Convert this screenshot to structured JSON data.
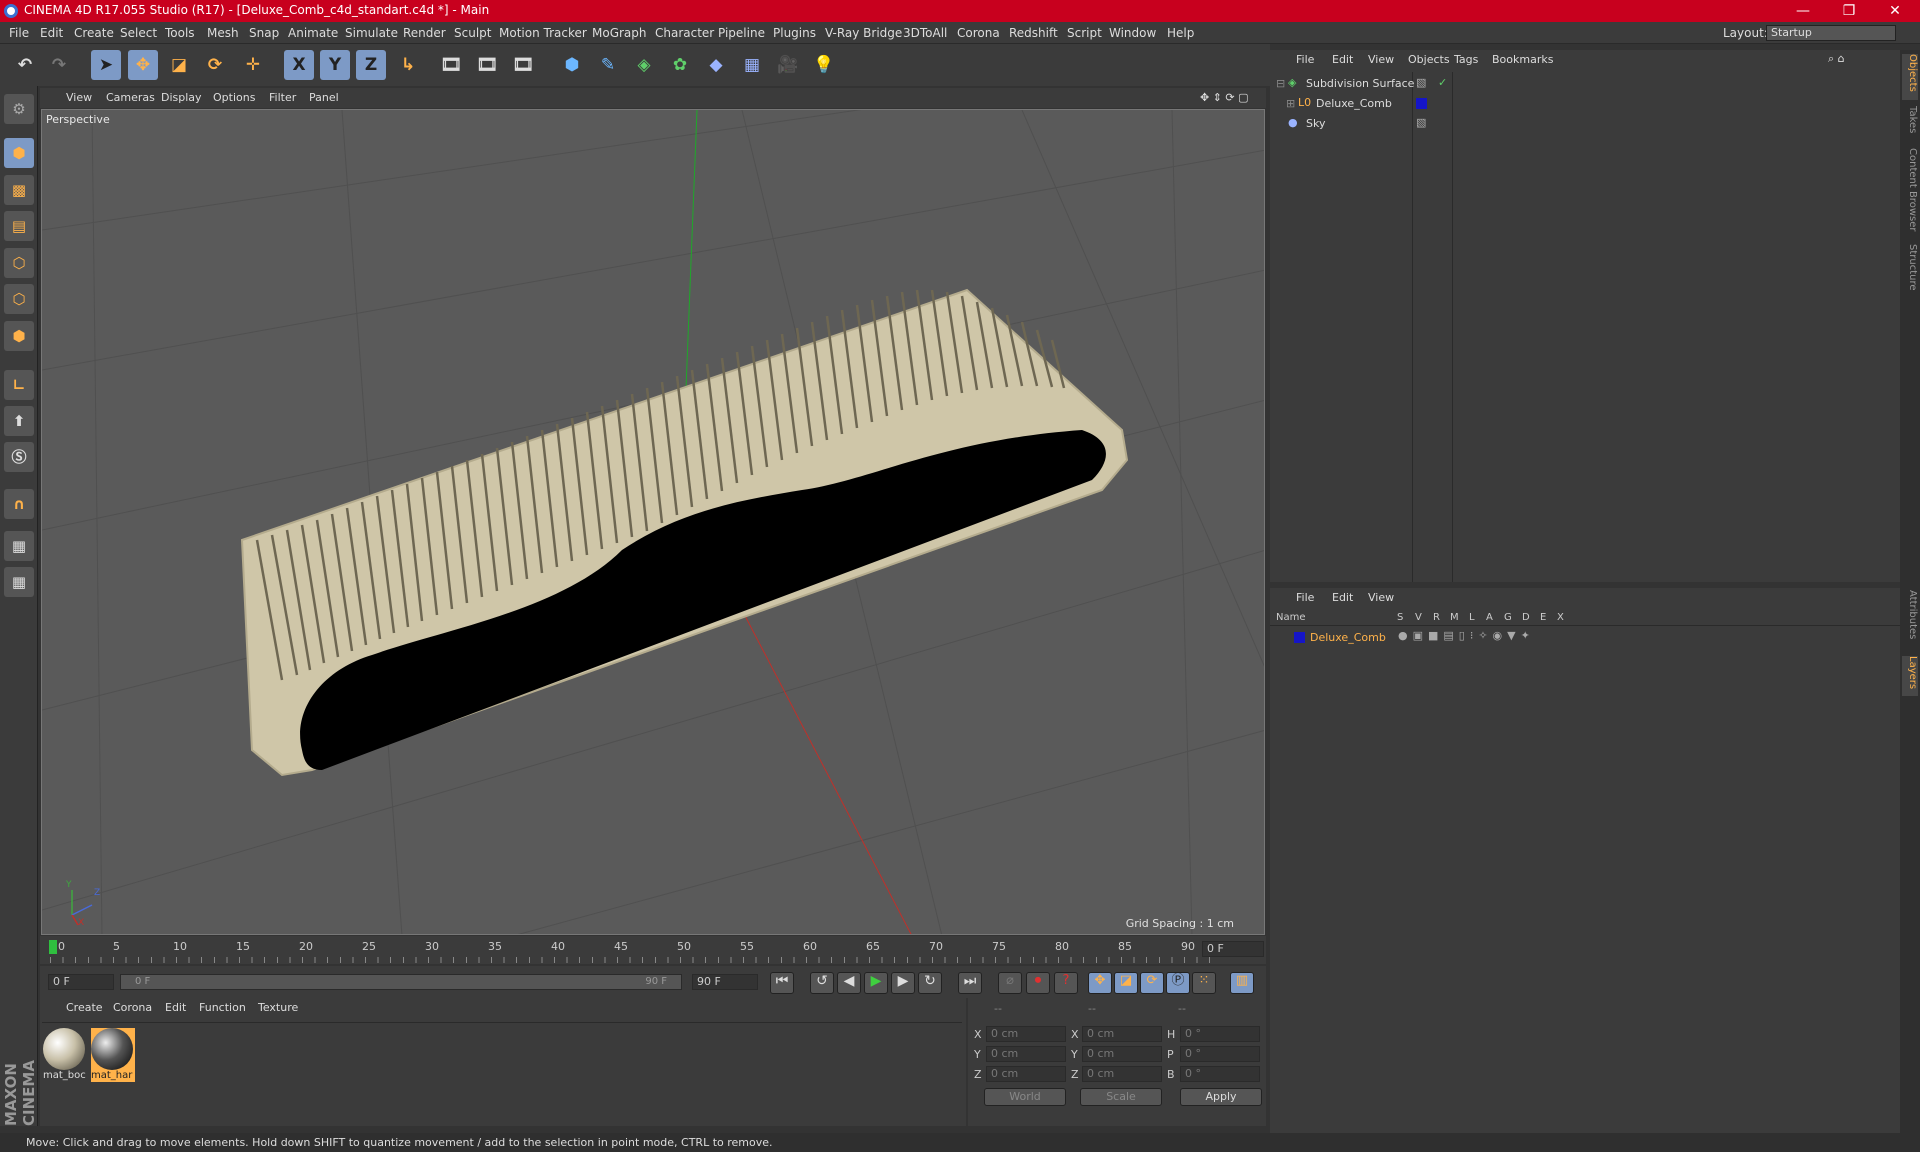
{
  "window": {
    "title": "CINEMA 4D R17.055 Studio (R17) - [Deluxe_Comb_c4d_standart.c4d *] - Main",
    "controls": [
      "—",
      "❐",
      "✕"
    ]
  },
  "menubar": {
    "items": [
      "File",
      "Edit",
      "Create",
      "Select",
      "Tools",
      "Mesh",
      "Snap",
      "Animate",
      "Simulate",
      "Render",
      "Sculpt",
      "Motion Tracker",
      "MoGraph",
      "Character",
      "Pipeline",
      "Plugins",
      "V-Ray Bridge",
      "3DToAll",
      "Corona",
      "Redshift",
      "Script",
      "Window",
      "Help"
    ],
    "layout_label": "Layout:",
    "layout_value": "Startup"
  },
  "toolbar": {
    "axis_x": "X",
    "axis_y": "Y",
    "axis_z": "Z"
  },
  "viewport": {
    "menu": [
      "View",
      "Cameras",
      "Display",
      "Options",
      "Filter",
      "Panel"
    ],
    "camera_label": "Perspective",
    "grid_spacing": "Grid Spacing : 1 cm",
    "axis_labels": {
      "x": "X",
      "y": "Y",
      "z": "Z"
    }
  },
  "timeline": {
    "ticks": [
      "0",
      "5",
      "10",
      "15",
      "20",
      "25",
      "30",
      "35",
      "40",
      "45",
      "50",
      "55",
      "60",
      "65",
      "70",
      "75",
      "80",
      "85",
      "90"
    ],
    "current_frame_field": "0 F",
    "start_field": "0 F",
    "range_start": "0 F",
    "range_end": "90 F",
    "end_field": "90 F"
  },
  "materials": {
    "menu": [
      "Create",
      "Corona",
      "Edit",
      "Function",
      "Texture"
    ],
    "items": [
      {
        "name": "mat_boc",
        "selected": false
      },
      {
        "name": "mat_har",
        "selected": true
      }
    ]
  },
  "coords": {
    "header": [
      "--",
      "--",
      "--"
    ],
    "rows": [
      {
        "a": "X",
        "av": "0 cm",
        "b": "X",
        "bv": "0 cm",
        "c": "H",
        "cv": "0 °"
      },
      {
        "a": "Y",
        "av": "0 cm",
        "b": "Y",
        "bv": "0 cm",
        "c": "P",
        "cv": "0 °"
      },
      {
        "a": "Z",
        "av": "0 cm",
        "b": "Z",
        "bv": "0 cm",
        "c": "B",
        "cv": "0 °"
      }
    ],
    "world": "World",
    "scale": "Scale",
    "apply": "Apply"
  },
  "object_manager": {
    "menu": [
      "File",
      "Edit",
      "View",
      "Objects",
      "Tags",
      "Bookmarks"
    ],
    "objects": [
      {
        "name": "Subdivision Surface"
      },
      {
        "name": "Deluxe_Comb"
      },
      {
        "name": "Sky"
      }
    ]
  },
  "layer_manager": {
    "menu": [
      "File",
      "Edit",
      "View"
    ],
    "columns": [
      "Name",
      "S",
      "V",
      "R",
      "M",
      "L",
      "A",
      "G",
      "D",
      "E",
      "X"
    ],
    "layers": [
      {
        "name": "Deluxe_Comb"
      }
    ]
  },
  "right_tabs": [
    "Objects",
    "Takes",
    "Content Browser",
    "Structure",
    "Attributes",
    "Layers"
  ],
  "status": "Move: Click and drag to move elements. Hold down SHIFT to quantize movement / add to the selection in point mode, CTRL to remove.",
  "branding": "MAXON CINEMA 4D",
  "colors": {
    "accent": "#ffb24a",
    "selected_tool": "#7d9ac6",
    "titlebar": "#c8001e",
    "layer_color": "#1515c8"
  }
}
